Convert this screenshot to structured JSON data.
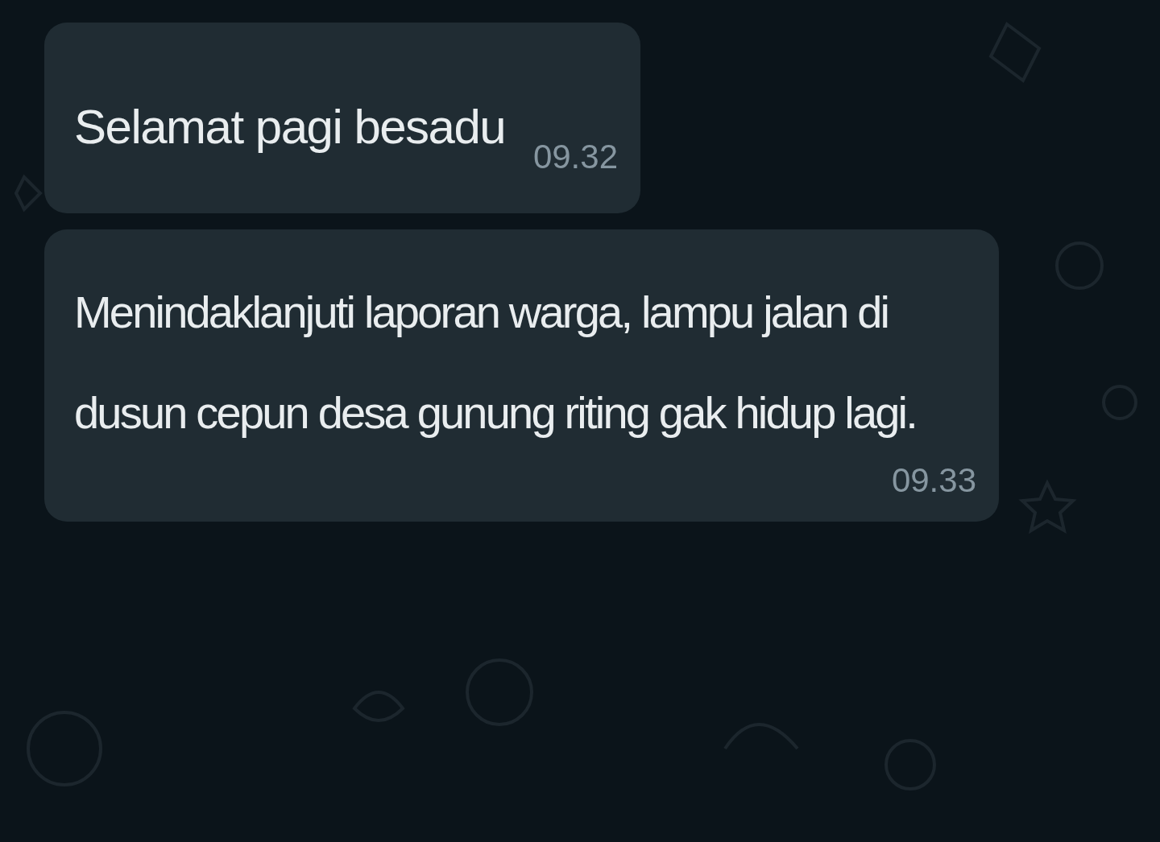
{
  "messages": [
    {
      "text": "Selamat pagi besadu",
      "time": "09.32"
    },
    {
      "text": "Menindaklanjuti laporan warga, lampu jalan di dusun cepun desa gunung riting gak hidup lagi.",
      "time": "09.33"
    }
  ]
}
